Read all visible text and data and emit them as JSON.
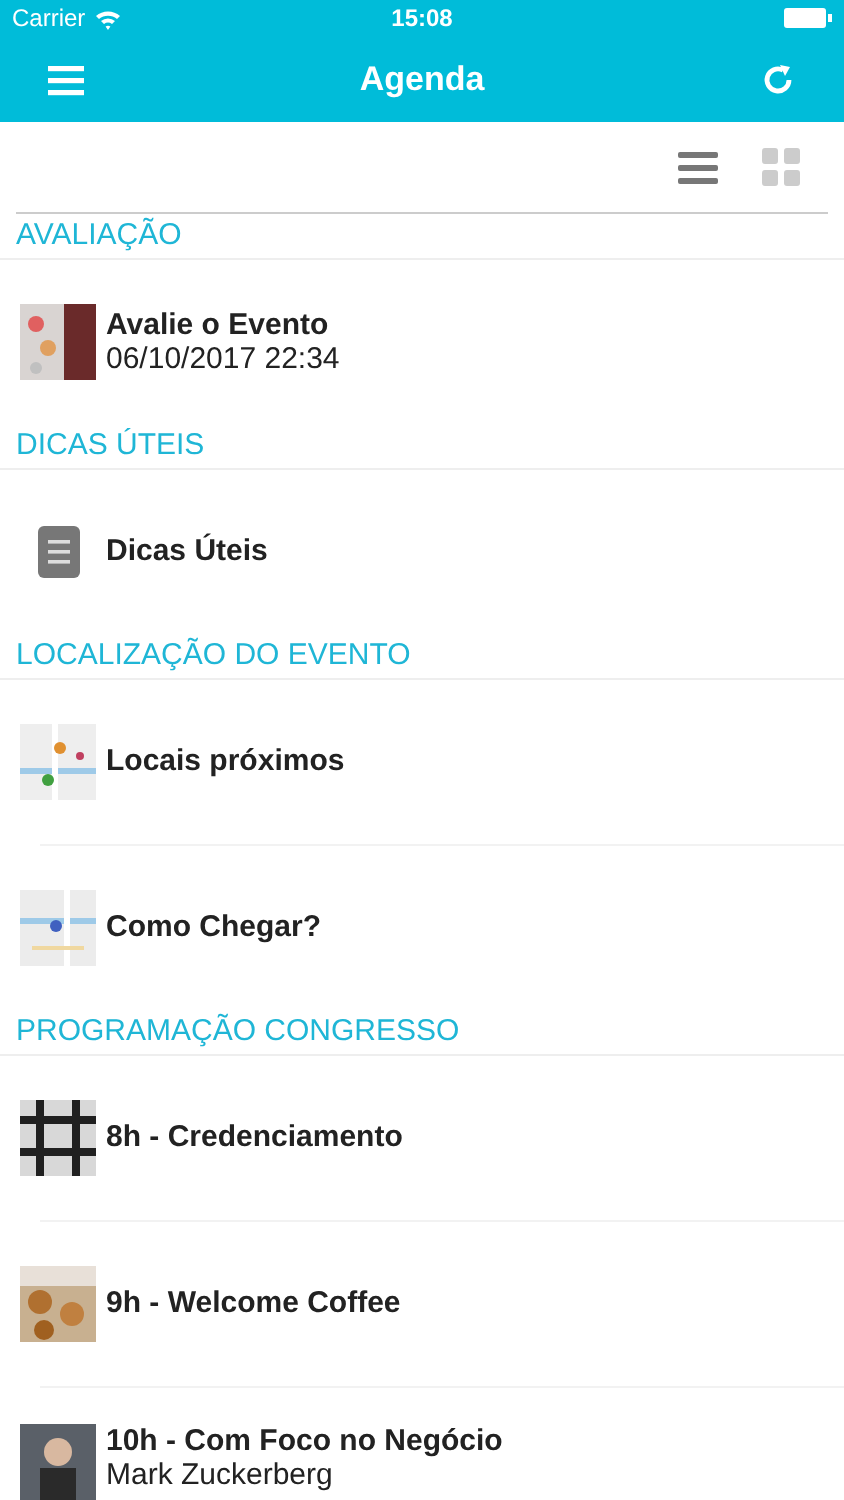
{
  "status_bar": {
    "carrier": "Carrier",
    "time": "15:08"
  },
  "nav": {
    "title": "Agenda"
  },
  "view_modes": [
    {
      "kind": "list",
      "selected": true
    },
    {
      "kind": "grid",
      "selected": false
    }
  ],
  "sections": [
    {
      "title": "AVALIAÇÃO",
      "items": [
        {
          "kind": "picture",
          "title": "Avalie o Evento",
          "subtitle": "06/10/2017 22:34"
        }
      ]
    },
    {
      "title": "DICAS ÚTEIS",
      "items": [
        {
          "kind": "document",
          "title": "Dicas Úteis"
        }
      ]
    },
    {
      "title": "LOCALIZAÇÃO DO EVENTO",
      "items": [
        {
          "kind": "picture",
          "title": "Locais próximos"
        },
        {
          "kind": "picture",
          "title": "Como Chegar?"
        }
      ]
    },
    {
      "title": "PROGRAMAÇÃO CONGRESSO",
      "items": [
        {
          "kind": "picture",
          "title": "8h - Credenciamento"
        },
        {
          "kind": "picture",
          "title": "9h - Welcome Coffee"
        },
        {
          "kind": "picture",
          "title": "10h - Com Foco no Negócio",
          "subtitle": "Mark Zuckerberg"
        }
      ]
    }
  ]
}
